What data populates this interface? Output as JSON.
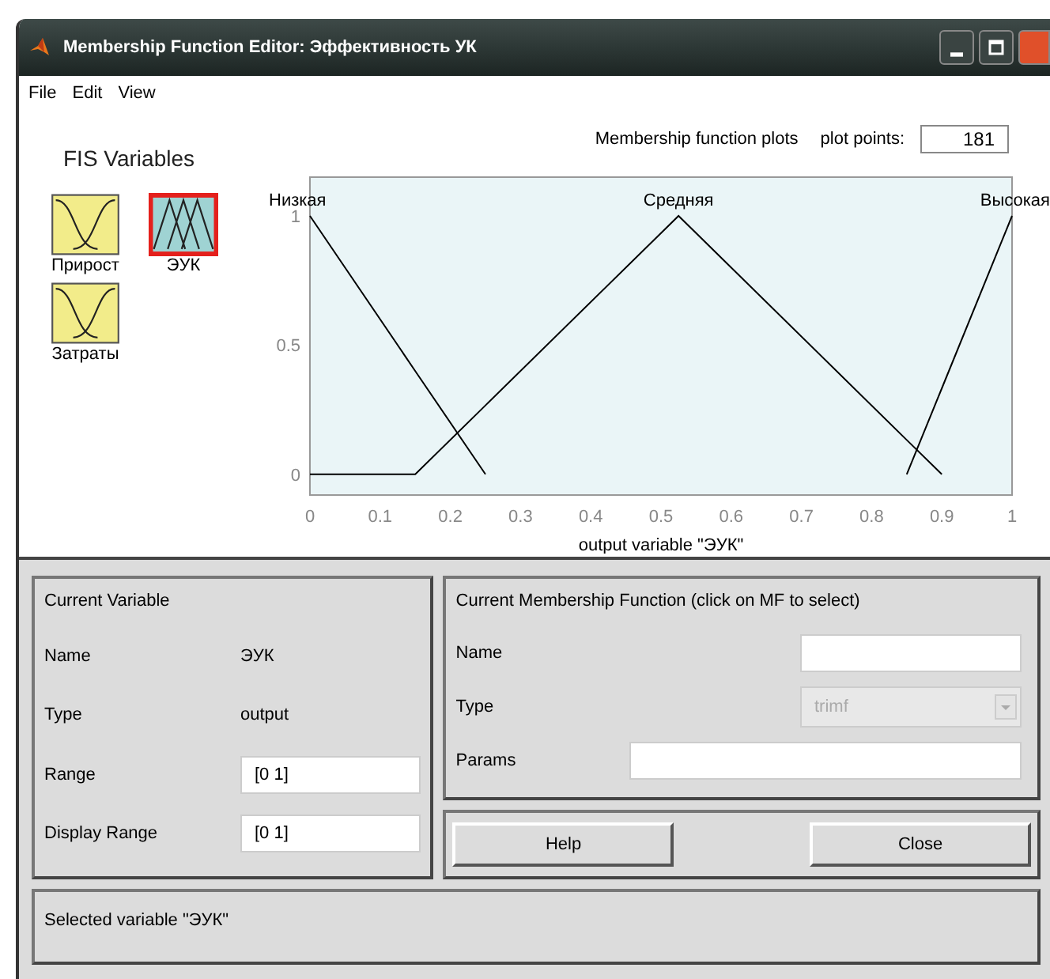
{
  "window": {
    "title": "Membership Function Editor: Эффективность УК"
  },
  "menu": [
    "File",
    "Edit",
    "View"
  ],
  "fis_variables": {
    "title": "FIS Variables",
    "items": [
      {
        "name": "Прирост",
        "kind": "input",
        "selected": false
      },
      {
        "name": "ЭУК",
        "kind": "output",
        "selected": true
      },
      {
        "name": "Затраты",
        "kind": "input",
        "selected": false
      }
    ]
  },
  "plot": {
    "title": "Membership function plots",
    "plot_points_label": "plot points:",
    "plot_points": "181",
    "chart_data": {
      "type": "line",
      "xlabel": "output variable \"ЭУК\"",
      "x": [
        0,
        0.15,
        0.25,
        0.525,
        0.85,
        0.9,
        1
      ],
      "xlim": [
        0,
        1
      ],
      "ylim": [
        -0.08,
        1.15
      ],
      "xticks": [
        0,
        0.1,
        0.2,
        0.3,
        0.4,
        0.5,
        0.6,
        0.7,
        0.8,
        0.9,
        1
      ],
      "yticks": [
        0,
        0.5,
        1
      ],
      "series": [
        {
          "name": "Низкая",
          "color": "#000000",
          "values": [
            1,
            0.4,
            0,
            null,
            null,
            null,
            null
          ]
        },
        {
          "name": "Средняя",
          "color": "#000000",
          "values": [
            0,
            0,
            0.267,
            1,
            0.133,
            0,
            null
          ]
        },
        {
          "name": "Высокая",
          "color": "#000000",
          "values": [
            null,
            null,
            null,
            null,
            0,
            0.333,
            1
          ]
        }
      ]
    }
  },
  "current_variable": {
    "title": "Current Variable",
    "fields": [
      {
        "label": "Name",
        "kind": "text",
        "value": "ЭУК"
      },
      {
        "label": "Type",
        "kind": "text",
        "value": "output"
      },
      {
        "label": "Range",
        "kind": "input",
        "value": "[0 1]"
      },
      {
        "label": "Display Range",
        "kind": "input",
        "value": "[0 1]"
      }
    ]
  },
  "current_mf": {
    "title": "Current Membership Function (click on MF to select)",
    "fields": [
      {
        "label": "Name",
        "kind": "input"
      },
      {
        "label": "Type",
        "kind": "dropdown",
        "value": "trimf",
        "disabled": true
      },
      {
        "label": "Params",
        "kind": "input"
      }
    ]
  },
  "buttons": [
    "Help",
    "Close"
  ],
  "status": "Selected variable \"ЭУК\""
}
